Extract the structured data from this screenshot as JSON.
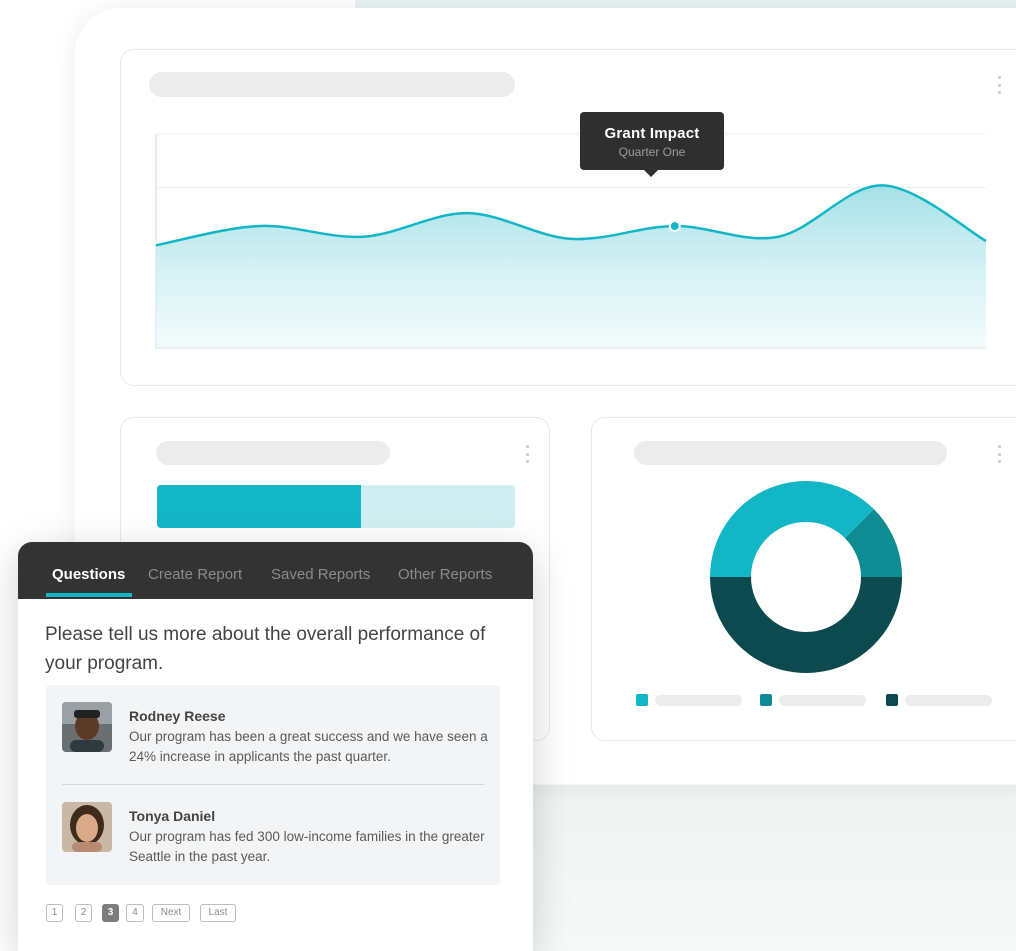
{
  "colors": {
    "accent": "#13b6c6",
    "accent_light": "#cfeff2",
    "teal_mid": "#0f8b94",
    "teal_dark": "#0c4a50",
    "panel_header": "#333333"
  },
  "main_chart": {
    "menu_icon": "kebab-vertical-icon",
    "tooltip": {
      "title": "Grant Impact",
      "subtitle": "Quarter One"
    },
    "chart_data": {
      "type": "area",
      "grid": true,
      "series": [
        {
          "values": [
            48,
            57,
            52,
            63,
            51,
            57,
            52,
            76,
            50
          ]
        }
      ],
      "highlighted_point_index": 5,
      "ylim": [
        0,
        100
      ]
    }
  },
  "bar_card": {
    "menu_icon": "kebab-vertical-icon",
    "progress": 0.57
  },
  "donut_card": {
    "menu_icon": "kebab-vertical-icon",
    "chart_data": {
      "type": "pie",
      "values": [
        37.5,
        12.5,
        50
      ]
    },
    "legend_swatches": [
      "#13b6c6",
      "#0f8b94",
      "#0c4a50"
    ]
  },
  "panel": {
    "tabs": [
      {
        "label": "Questions",
        "active": true
      },
      {
        "label": "Create Report",
        "active": false
      },
      {
        "label": "Saved Reports",
        "active": false
      },
      {
        "label": "Other Reports",
        "active": false
      }
    ],
    "question": "Please tell us more about the overall performance of your program.",
    "answers": [
      {
        "name": "Rodney Reese",
        "text": "Our program has been a great success and we have seen a 24% increase in applicants the past quarter."
      },
      {
        "name": "Tonya Daniel",
        "text": "Our program has fed 300 low-income families in the greater Seattle in the past year."
      }
    ],
    "pagination": {
      "pages": [
        "1",
        "2",
        "3",
        "4"
      ],
      "current": "3",
      "next_label": "Next",
      "last_label": "Last"
    }
  }
}
